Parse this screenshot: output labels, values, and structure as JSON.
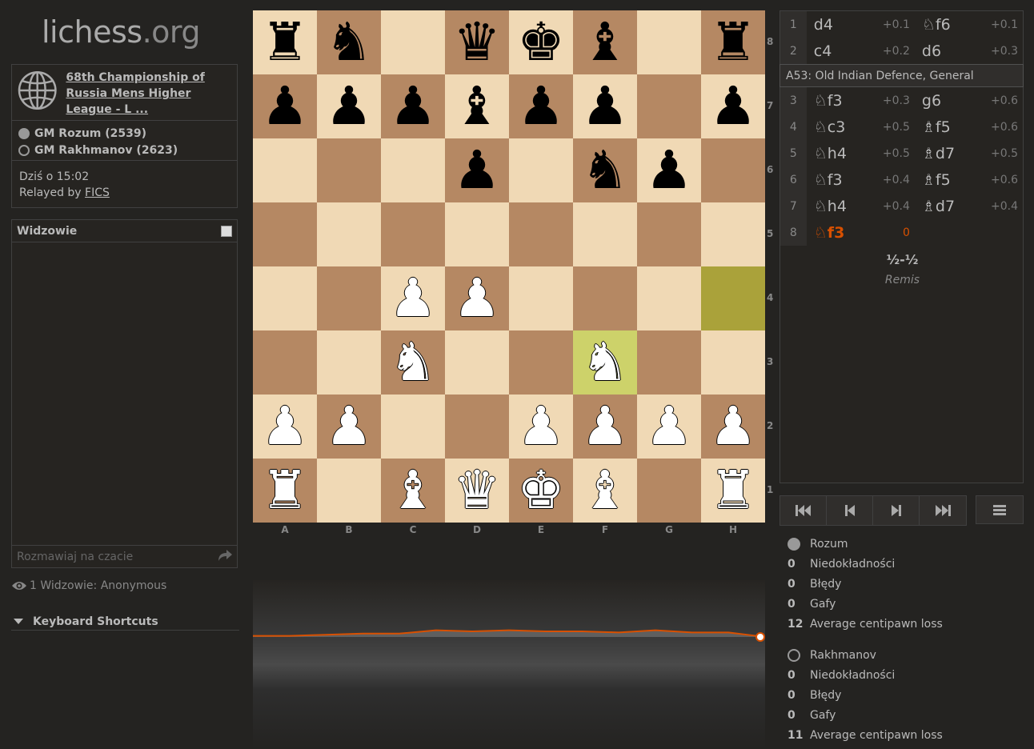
{
  "logo": {
    "name": "lichess",
    "tld": ".org"
  },
  "game": {
    "title": "68th Championship of Russia Mens Higher League - L ...",
    "players": [
      {
        "label": "GM Rozum (2539)",
        "color": "white"
      },
      {
        "label": "GM Rakhmanov (2623)",
        "color": "black"
      }
    ],
    "date": "Dziś o 15:02",
    "relay_prefix": "Relayed by ",
    "relay_link": "FICS"
  },
  "chat": {
    "title": "Widzowie",
    "placeholder": "Rozmawiaj na czacie"
  },
  "watchers": "1 Widzowie: Anonymous",
  "shortcuts": "Keyboard Shortcuts",
  "board": {
    "ranks": [
      "8",
      "7",
      "6",
      "5",
      "4",
      "3",
      "2",
      "1"
    ],
    "files": [
      "A",
      "B",
      "C",
      "D",
      "E",
      "F",
      "G",
      "H"
    ],
    "position": [
      [
        "r",
        "n",
        "",
        "q",
        "k",
        "b",
        "",
        "r"
      ],
      [
        "p",
        "p",
        "p",
        "b",
        "p",
        "p",
        "",
        "p"
      ],
      [
        "",
        "",
        "",
        "p",
        "",
        "n",
        "p",
        ""
      ],
      [
        "",
        "",
        "",
        "",
        "",
        "",
        "",
        ""
      ],
      [
        "",
        "",
        "P",
        "P",
        "",
        "",
        "",
        ""
      ],
      [
        "",
        "",
        "N",
        "",
        "",
        "N",
        "",
        ""
      ],
      [
        "P",
        "P",
        "",
        "",
        "P",
        "P",
        "P",
        "P"
      ],
      [
        "R",
        "",
        "B",
        "Q",
        "K",
        "B",
        "",
        "R"
      ]
    ],
    "last_move": [
      "h4",
      "f3"
    ]
  },
  "moves": {
    "rows": [
      {
        "num": "1",
        "white": "d4",
        "white_eval": "+0.1",
        "black": "♘f6",
        "black_eval": "+0.1"
      },
      {
        "num": "2",
        "white": "c4",
        "white_eval": "+0.2",
        "black": "d6",
        "black_eval": "+0.3"
      },
      {
        "num": "3",
        "white": "♘f3",
        "white_eval": "+0.3",
        "black": "g6",
        "black_eval": "+0.6"
      },
      {
        "num": "4",
        "white": "♘c3",
        "white_eval": "+0.5",
        "black": "♗f5",
        "black_eval": "+0.6"
      },
      {
        "num": "5",
        "white": "♘h4",
        "white_eval": "+0.5",
        "black": "♗d7",
        "black_eval": "+0.5"
      },
      {
        "num": "6",
        "white": "♘f3",
        "white_eval": "+0.4",
        "black": "♗f5",
        "black_eval": "+0.6"
      },
      {
        "num": "7",
        "white": "♘h4",
        "white_eval": "+0.4",
        "black": "♗d7",
        "black_eval": "+0.4"
      },
      {
        "num": "8",
        "white": "♘f3",
        "white_eval": "0",
        "black": "",
        "black_eval": ""
      }
    ],
    "opening": "A53: Old Indian Defence, General",
    "result": "½-½",
    "result_text": "Remis"
  },
  "stats": {
    "white": {
      "name": "Rozum",
      "inaccuracies": "0",
      "inaccuracies_label": "Niedokładności",
      "mistakes": "0",
      "mistakes_label": "Błędy",
      "blunders": "0",
      "blunders_label": "Gafy",
      "acpl": "12",
      "acpl_label": "Average centipawn loss"
    },
    "black": {
      "name": "Rakhmanov",
      "inaccuracies": "0",
      "inaccuracies_label": "Niedokładności",
      "mistakes": "0",
      "mistakes_label": "Błędy",
      "blunders": "0",
      "blunders_label": "Gafy",
      "acpl": "11",
      "acpl_label": "Average centipawn loss"
    }
  },
  "eval_chart": {
    "values": [
      0.1,
      0.1,
      0.2,
      0.3,
      0.3,
      0.6,
      0.5,
      0.6,
      0.5,
      0.5,
      0.4,
      0.6,
      0.4,
      0.4,
      0
    ],
    "line_color": "#d85000"
  }
}
